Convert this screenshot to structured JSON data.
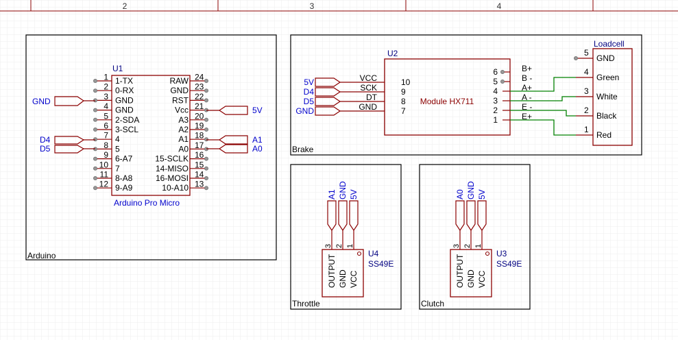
{
  "ruler": [
    "2",
    "3",
    "4"
  ],
  "colors": {
    "wire": "#8b0000",
    "green": "#008000",
    "blue": "#0000cc",
    "grid": "#e8e8e8",
    "frame": "#000000"
  },
  "frames": {
    "arduino": "Arduino",
    "brake": "Brake",
    "throttle": "Throttle",
    "clutch": "Clutch"
  },
  "u1": {
    "ref": "U1",
    "name": "Arduino Pro Micro",
    "left_pins": [
      {
        "num": "1",
        "label": "1-TX"
      },
      {
        "num": "2",
        "label": "0-RX"
      },
      {
        "num": "3",
        "label": "GND"
      },
      {
        "num": "4",
        "label": "GND"
      },
      {
        "num": "5",
        "label": "2-SDA"
      },
      {
        "num": "6",
        "label": "3-SCL"
      },
      {
        "num": "7",
        "label": "4"
      },
      {
        "num": "8",
        "label": "5"
      },
      {
        "num": "9",
        "label": "6-A7"
      },
      {
        "num": "10",
        "label": "7"
      },
      {
        "num": "11",
        "label": "8-A8"
      },
      {
        "num": "12",
        "label": "9-A9"
      }
    ],
    "right_pins": [
      {
        "num": "24",
        "label": "RAW"
      },
      {
        "num": "23",
        "label": "GND"
      },
      {
        "num": "22",
        "label": "RST"
      },
      {
        "num": "21",
        "label": "Vcc"
      },
      {
        "num": "20",
        "label": "A3"
      },
      {
        "num": "19",
        "label": "A2"
      },
      {
        "num": "18",
        "label": "A1"
      },
      {
        "num": "17",
        "label": "A0"
      },
      {
        "num": "16",
        "label": "15-SCLK"
      },
      {
        "num": "15",
        "label": "14-MISO"
      },
      {
        "num": "14",
        "label": "16-MOSI"
      },
      {
        "num": "13",
        "label": "10-A10"
      }
    ],
    "net_labels": {
      "gnd": "GND",
      "d4": "D4",
      "d5": "D5",
      "v5": "5V",
      "a1": "A1",
      "a0": "A0"
    }
  },
  "u2": {
    "ref": "U2",
    "name": "Module HX711",
    "left_pins": [
      {
        "num": "10",
        "label": "VCC",
        "net": "5V"
      },
      {
        "num": "9",
        "label": "SCK",
        "net": "D4"
      },
      {
        "num": "8",
        "label": "DT",
        "net": "D5"
      },
      {
        "num": "7",
        "label": "GND",
        "net": "GND"
      }
    ],
    "right_pins": [
      {
        "num": "6",
        "label": "B+"
      },
      {
        "num": "5",
        "label": "B -"
      },
      {
        "num": "4",
        "label": "A+"
      },
      {
        "num": "3",
        "label": "A -"
      },
      {
        "num": "2",
        "label": "E -"
      },
      {
        "num": "1",
        "label": "E+"
      }
    ]
  },
  "loadcell": {
    "title": "Loadcell",
    "pins": [
      {
        "num": "5",
        "label": "GND"
      },
      {
        "num": "4",
        "label": "Green"
      },
      {
        "num": "3",
        "label": "White"
      },
      {
        "num": "2",
        "label": "Black"
      },
      {
        "num": "1",
        "label": "Red"
      }
    ]
  },
  "u4": {
    "ref": "U4",
    "part": "SS49E",
    "pins": [
      {
        "num": "3",
        "label": "OUTPUT"
      },
      {
        "num": "2",
        "label": "GND"
      },
      {
        "num": "1",
        "label": "VCC"
      }
    ],
    "nets": [
      "A1",
      "GND",
      "5V"
    ]
  },
  "u3": {
    "ref": "U3",
    "part": "SS49E",
    "pins": [
      {
        "num": "3",
        "label": "OUTPUT"
      },
      {
        "num": "2",
        "label": "GND"
      },
      {
        "num": "1",
        "label": "VCC"
      }
    ],
    "nets": [
      "A0",
      "GND",
      "5V"
    ]
  }
}
